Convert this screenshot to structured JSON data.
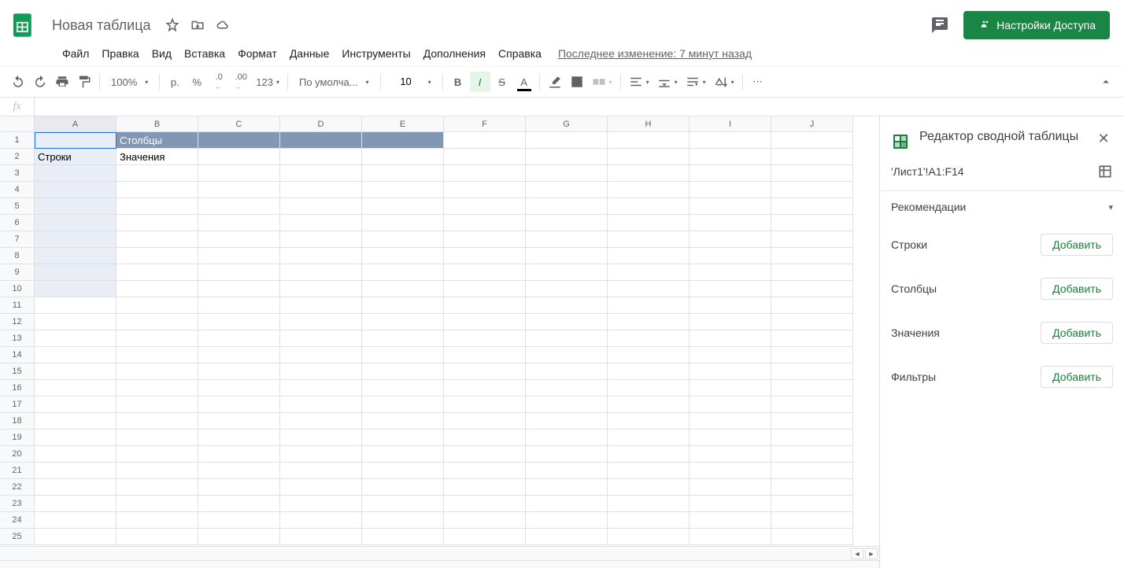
{
  "doc": {
    "title": "Новая таблица"
  },
  "menus": [
    "Файл",
    "Правка",
    "Вид",
    "Вставка",
    "Формат",
    "Данные",
    "Инструменты",
    "Дополнения",
    "Справка"
  ],
  "last_edit": "Последнее изменение: 7 минут назад",
  "share": {
    "label": "Настройки Доступа"
  },
  "toolbar": {
    "zoom": "100%",
    "currency": "р.",
    "percent": "%",
    "dec_dec": ".0",
    "inc_dec": ".00",
    "more_formats": "123",
    "font": "По умолча...",
    "font_size": "10"
  },
  "fx": {
    "value": ""
  },
  "columns": [
    "A",
    "B",
    "C",
    "D",
    "E",
    "F",
    "G",
    "H",
    "I",
    "J"
  ],
  "rows_count": 25,
  "cells": {
    "B1": "Столбцы",
    "A2": "Строки",
    "B2": "Значения"
  },
  "sidepanel": {
    "title": "Редактор сводной таблицы",
    "range": "'Лист1'!A1:F14",
    "recs": "Рекомендации",
    "rows": "Строки",
    "cols": "Столбцы",
    "vals": "Значения",
    "filters": "Фильтры",
    "add": "Добавить"
  }
}
